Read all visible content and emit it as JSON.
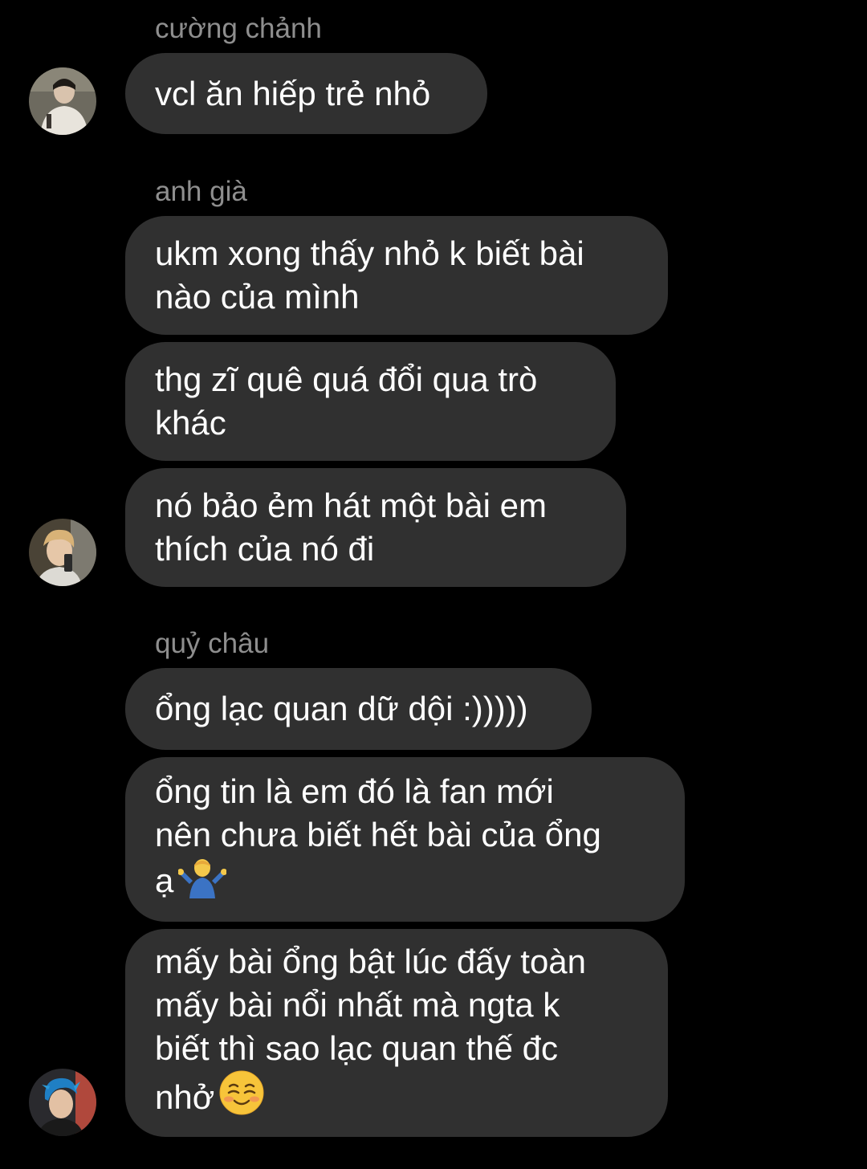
{
  "messages": {
    "g1": {
      "sender": "cường chảnh",
      "m1": "vcl ăn hiếp trẻ nhỏ"
    },
    "g2": {
      "sender": "anh già",
      "m1": "ukm xong thấy nhỏ k biết bài\nnào của mình",
      "m2": "thg zĩ quê quá đổi qua trò\nkhác",
      "m3": "nó bảo ẻm hát một bài em\nthích của nó đi"
    },
    "g3": {
      "sender": "quỷ châu",
      "m1": "ổng lạc quan dữ dội :)))))",
      "m2": "ổng tin là em đó là fan mới\nnên chưa biết hết bài của ổng\nạ",
      "m3": "mấy bài ổng bật lúc đấy toàn\nmấy bài nổi nhất mà ngta k\nbiết thì sao lạc quan thế đc\nnhở"
    }
  },
  "icons": {
    "avatar1": "avatar-photo",
    "avatar2": "avatar-photo",
    "avatar3": "avatar-photo",
    "emoji_shrug": "person-shrugging-emoji",
    "emoji_smile": "smiling-face-emoji"
  },
  "colors": {
    "background": "#000000",
    "bubble": "#303030",
    "sender_name": "#8e8e8e",
    "text": "#ffffff"
  }
}
